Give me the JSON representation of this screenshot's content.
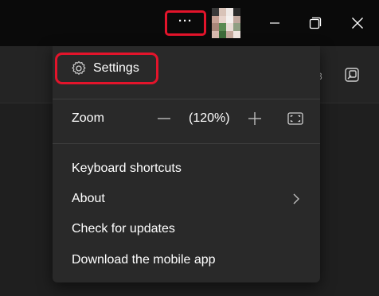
{
  "titlebar": {
    "more_label": "···",
    "icons": {
      "more": "more-horizontal-icon",
      "minimize": "minimize-icon",
      "restore": "restore-icon",
      "close": "close-icon"
    }
  },
  "background": {
    "peek_count": "3",
    "popout_icon": "popout-icon"
  },
  "menu": {
    "settings": {
      "label": "Settings",
      "icon": "gear-icon"
    },
    "zoom": {
      "label": "Zoom",
      "value": "(120%)",
      "minus_icon": "minus-icon",
      "plus_icon": "plus-icon",
      "fit_icon": "fit-screen-icon"
    },
    "items": [
      {
        "label": "Keyboard shortcuts"
      },
      {
        "label": "About",
        "icon": "chevron-right-icon"
      },
      {
        "label": "Check for updates"
      },
      {
        "label": "Download the mobile app"
      }
    ]
  },
  "colors": {
    "titlebar_bg": "#0a0a0a",
    "menu_bg": "#292929",
    "highlight": "#e3142b",
    "text": "#ffffff"
  }
}
